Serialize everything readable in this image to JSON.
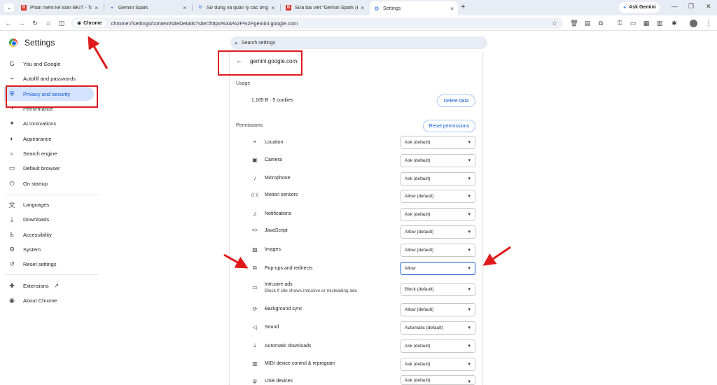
{
  "tabs": [
    {
      "title": "Phần mềm kế toán BKIT - Tiện...",
      "favicon": "B",
      "color": "#d93025"
    },
    {
      "title": "Gemini Spark",
      "favicon": "✦",
      "color": "#4285f4"
    },
    {
      "title": "Sử dụng và quản lý các ứng dụ...",
      "favicon": "G",
      "color": "#4285f4"
    },
    {
      "title": "Sửa bài viết “Gemini Spark (Bet...",
      "favicon": "B",
      "color": "#d93025"
    },
    {
      "title": "Settings",
      "favicon": "⚙",
      "color": "#1a73e8"
    }
  ],
  "ask_gemini": "Ask Gemini",
  "omnibox": {
    "chip": "Chrome",
    "url": "chrome://settings/content/siteDetails?site=https%3A%2F%2Fgemini.google.com"
  },
  "settings_title": "Settings",
  "search_placeholder": "Search settings",
  "sidebar": {
    "items": [
      {
        "label": "You and Google",
        "icon": "G"
      },
      {
        "label": "Autofill and passwords",
        "icon": "⌁"
      },
      {
        "label": "Privacy and security",
        "icon": "⛨"
      },
      {
        "label": "Performance",
        "icon": "◔"
      },
      {
        "label": "AI innovations",
        "icon": "✦"
      },
      {
        "label": "Appearance",
        "icon": "◐"
      },
      {
        "label": "Search engine",
        "icon": "⌕"
      },
      {
        "label": "Default browser",
        "icon": "▭"
      },
      {
        "label": "On startup",
        "icon": "⏻"
      },
      {
        "label": "Languages",
        "icon": "文"
      },
      {
        "label": "Downloads",
        "icon": "⤓"
      },
      {
        "label": "Accessibility",
        "icon": "♿"
      },
      {
        "label": "System",
        "icon": "⚙"
      },
      {
        "label": "Reset settings",
        "icon": "↺"
      },
      {
        "label": "Extensions",
        "icon": "✚"
      },
      {
        "label": "About Chrome",
        "icon": "◉"
      }
    ]
  },
  "site": "gemini.google.com",
  "usage": {
    "label": "Usage",
    "value": "1,165 B · 5 cookies",
    "delete_label": "Delete data"
  },
  "permissions": {
    "label": "Permissions",
    "reset_label": "Reset permissions",
    "items": [
      {
        "label": "Location",
        "value": "Ask (default)",
        "icon": "⌖"
      },
      {
        "label": "Camera",
        "value": "Ask (default)",
        "icon": "▣"
      },
      {
        "label": "Microphone",
        "value": "Ask (default)",
        "icon": "🎙"
      },
      {
        "label": "Motion sensors",
        "value": "Allow (default)",
        "icon": "((·))"
      },
      {
        "label": "Notifications",
        "value": "Ask (default)",
        "icon": "🔔"
      },
      {
        "label": "JavaScript",
        "value": "Allow (default)",
        "icon": "<>"
      },
      {
        "label": "Images",
        "value": "Allow (default)",
        "icon": "▨"
      },
      {
        "label": "Pop-ups and redirects",
        "value": "Allow",
        "icon": "⧉"
      },
      {
        "label": "Intrusive ads",
        "sub": "Block if site shows intrusive or misleading ads",
        "value": "Block (default)",
        "icon": "▭"
      },
      {
        "label": "Background sync",
        "value": "Allow (default)",
        "icon": "⟳"
      },
      {
        "label": "Sound",
        "value": "Automatic (default)",
        "icon": "🔈"
      },
      {
        "label": "Automatic downloads",
        "value": "Ask (default)",
        "icon": "⤓"
      },
      {
        "label": "MIDI device control & reprogram",
        "value": "Ask (default)",
        "icon": "▥"
      },
      {
        "label": "USB devices",
        "value": "Ask (default)",
        "icon": "ψ"
      }
    ]
  },
  "colors": {
    "accent": "#0b57d0",
    "annotation": "#e0191b",
    "active_nav": "#d3e3fd"
  }
}
